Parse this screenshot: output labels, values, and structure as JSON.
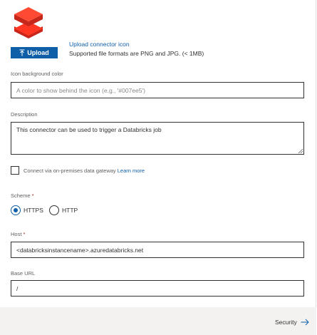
{
  "general": {
    "upload_button_label": "Upload",
    "upload_link_text": "Upload connector icon",
    "upload_note": "Supported file formats are PNG and JPG. (< 1MB)",
    "icon_background": {
      "label": "Icon background color",
      "placeholder": "A color to show behind the icon (e.g., '#007ee5')",
      "value": ""
    },
    "description": {
      "label": "Description",
      "value": "This connector can be used to trigger a Databricks job"
    },
    "gateway": {
      "label": "Connect via on-premises data gateway",
      "learn_more": "Learn more",
      "checked": false
    },
    "scheme": {
      "label": "Scheme",
      "required_mark": "*",
      "options": [
        {
          "label": "HTTPS",
          "selected": true
        },
        {
          "label": "HTTP",
          "selected": false
        }
      ]
    },
    "host": {
      "label": "Host",
      "required_mark": "*",
      "value": "<databricksinstancename>.azuredatabricks.net"
    },
    "base_url": {
      "label": "Base URL",
      "value": "/"
    }
  },
  "footer": {
    "next_label": "Security"
  },
  "colors": {
    "accent": "#0f5fa8",
    "logo_red": "#ff3621",
    "footer_bg": "#f3f2f1"
  },
  "icons": {
    "logo": "databricks-logo-icon",
    "upload": "upload-arrow-icon",
    "next": "arrow-right-icon"
  }
}
